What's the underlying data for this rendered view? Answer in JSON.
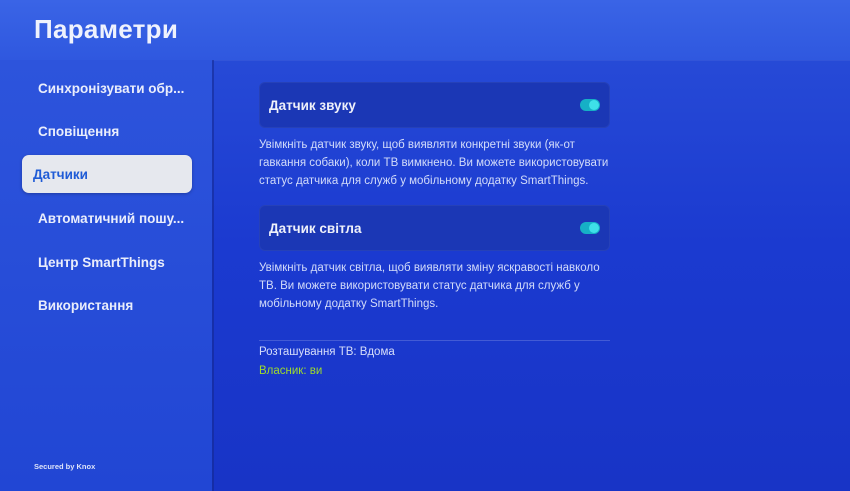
{
  "header": {
    "title": "Параметри"
  },
  "sidebar": {
    "items": [
      {
        "label": "Синхронізувати обр..."
      },
      {
        "label": "Сповіщення"
      },
      {
        "label": "Датчики",
        "selected": true
      },
      {
        "label": "Автоматичний пошу..."
      },
      {
        "label": "Центр SmartThings"
      },
      {
        "label": "Використання"
      }
    ],
    "footer": "Secured by Knox"
  },
  "main": {
    "sound_sensor": {
      "label": "Датчик звуку",
      "enabled": true,
      "description": "Увімкніть датчик звуку, щоб виявляти конкретні звуки (як-от гавкання собаки), коли ТВ вимкнено. Ви можете використовувати статус датчика для служб у мобільному додатку SmartThings."
    },
    "light_sensor": {
      "label": "Датчик світла",
      "enabled": true,
      "description": "Увімкніть датчик світла, щоб виявляти зміну яскравості навколо ТВ. Ви можете використовувати статус датчика для служб у мобільному додатку SmartThings."
    },
    "tv_location": "Розташування ТВ: Вдома",
    "owner": "Власник: ви"
  },
  "colors": {
    "background": "#1b3ad0",
    "selected_item_text": "#1f5bd6",
    "toggle_on": "#16b0c6",
    "owner_text": "#9fdc2a"
  }
}
